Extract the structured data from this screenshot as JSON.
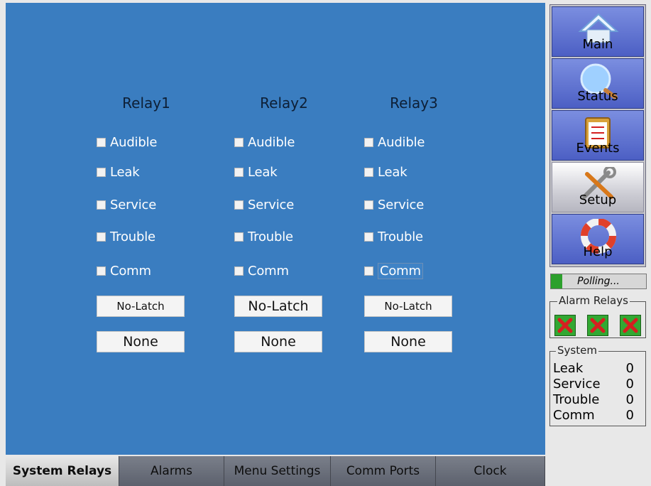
{
  "relays": [
    {
      "title": "Relay1",
      "options": [
        "Audible",
        "Leak",
        "Service",
        "Trouble",
        "Comm"
      ],
      "latch_button": "No-Latch",
      "mode_button": "None"
    },
    {
      "title": "Relay2",
      "options": [
        "Audible",
        "Leak",
        "Service",
        "Trouble",
        "Comm"
      ],
      "latch_button": "No-Latch",
      "mode_button": "None"
    },
    {
      "title": "Relay3",
      "options": [
        "Audible",
        "Leak",
        "Service",
        "Trouble",
        "Comm"
      ],
      "latch_button": "No-Latch",
      "mode_button": "None"
    }
  ],
  "sidebar": {
    "items": [
      {
        "label": "Main",
        "icon": "house-icon"
      },
      {
        "label": "Status",
        "icon": "magnifier-icon"
      },
      {
        "label": "Events",
        "icon": "clipboard-icon"
      },
      {
        "label": "Setup",
        "icon": "tools-icon",
        "active": true
      },
      {
        "label": "Help",
        "icon": "lifebuoy-icon"
      }
    ]
  },
  "polling": {
    "text": "Polling...",
    "progress": 0.12
  },
  "alarm_relays": {
    "legend": "Alarm Relays",
    "states": [
      "off",
      "off",
      "off"
    ]
  },
  "system": {
    "legend": "System",
    "rows": [
      {
        "label": "Leak",
        "value": "0"
      },
      {
        "label": "Service",
        "value": "0"
      },
      {
        "label": "Trouble",
        "value": "0"
      },
      {
        "label": "Comm",
        "value": "0"
      }
    ]
  },
  "tabs": [
    {
      "label": "System Relays",
      "active": true
    },
    {
      "label": "Alarms"
    },
    {
      "label": "Menu Settings"
    },
    {
      "label": "Comm Ports"
    },
    {
      "label": "Clock"
    }
  ],
  "colors": {
    "panel": "#3a7dc0",
    "nav_button": "#5b6fd0",
    "alarm_green": "#32a832",
    "alarm_x": "#d42020"
  }
}
